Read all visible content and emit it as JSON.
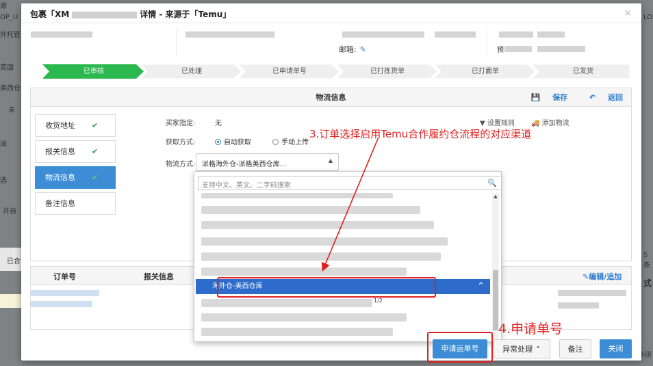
{
  "background": {
    "left_texts": [
      "源",
      "OP_U",
      "外托管",
      "英国",
      "美西仓",
      "未",
      "间",
      "选",
      "并自",
      "已合"
    ],
    "right_texts": [
      "LO",
      "5条",
      "式",
      "多研"
    ]
  },
  "modal": {
    "title_prefix": "包裹「XM",
    "title_suffix": "详情 - 来源于「Temu」",
    "close_label": "×",
    "postcode_label": "邮箱:",
    "postcode_partial": "预"
  },
  "steps": [
    {
      "label": "已审核",
      "active": true
    },
    {
      "label": "已处理",
      "active": false
    },
    {
      "label": "已申请单号",
      "active": false
    },
    {
      "label": "已打拣货单",
      "active": false
    },
    {
      "label": "已打面单",
      "active": false
    },
    {
      "label": "已发货",
      "active": false
    }
  ],
  "panel": {
    "title": "物流信息",
    "save_label": "保存",
    "back_label": "返回"
  },
  "side_tabs": [
    {
      "label": "收货地址",
      "checked": true,
      "active": false
    },
    {
      "label": "报关信息",
      "checked": true,
      "active": false
    },
    {
      "label": "物流信息",
      "checked": true,
      "active": true
    },
    {
      "label": "备注信息",
      "checked": false,
      "active": false
    }
  ],
  "form": {
    "buyer_label": "买家指定:",
    "buyer_value": "无",
    "method_label": "获取方式:",
    "auto_label": "自动获取",
    "manual_label": "手动上传",
    "logistics_label": "物流方式:",
    "logistics_value": "派格海外仓-派格美西仓库...",
    "set_rule_label": "设置规则",
    "add_logistics_label": "添加物流"
  },
  "dropdown": {
    "search_placeholder": "支持中文、英文、二字码搜索",
    "selected_prefix": "海外仓-",
    "selected_mid": "美西仓库",
    "selected_tail": "1/2"
  },
  "table": {
    "col_order": "订单号",
    "col_customs": "报关信息",
    "edit_add_label": "编辑/追加"
  },
  "footer": {
    "apply_label": "申请运单号",
    "exception_label": "异常处理",
    "note_label": "备注",
    "close_label": "关闭"
  },
  "annotations": {
    "step3": "3.订单选择启用Temu合作履约仓流程的对应渠道",
    "step4": "4.申请单号"
  },
  "colors": {
    "active_step": "#2bb84f",
    "primary": "#3c8dd6",
    "annotation": "#e02020"
  }
}
